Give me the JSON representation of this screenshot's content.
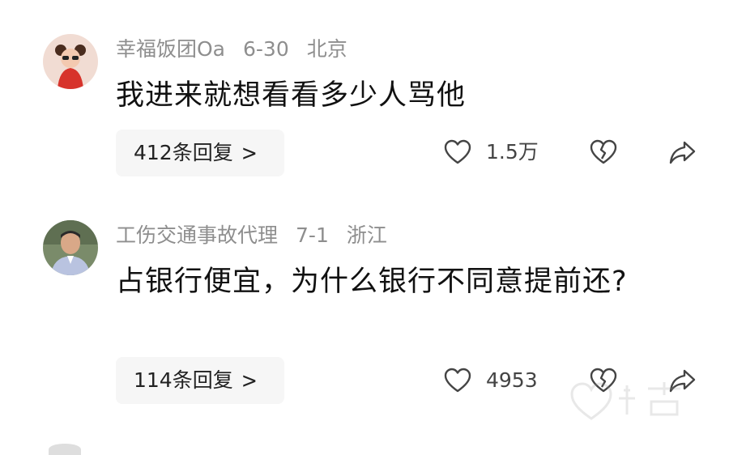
{
  "comments": [
    {
      "username": "幸福饭团Oa",
      "date": "6-30",
      "location": "北京",
      "text": "我进来就想看看多少人骂他",
      "replies_label": "412条回复",
      "likes": "1.5万"
    },
    {
      "username": "工伤交通事故代理",
      "date": "7-1",
      "location": "浙江",
      "text": "占银行便宜，为什么银行不同意提前还?",
      "replies_label": "114条回复",
      "likes": "4953"
    }
  ],
  "icons": {
    "like": "heart-icon",
    "dislike": "broken-heart-icon",
    "share": "share-arrow-icon",
    "chevron": "chevron-right-icon"
  },
  "colors": {
    "meta_gray": "#8e8e8e",
    "reply_bg": "#f6f6f6",
    "text": "#111111"
  }
}
